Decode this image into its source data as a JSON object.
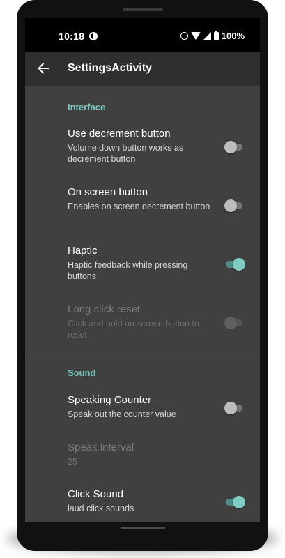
{
  "status_bar": {
    "time": "10:18",
    "battery": "100%"
  },
  "app_bar": {
    "title": "SettingsActivity"
  },
  "categories": {
    "interface": "Interface",
    "sound": "Sound"
  },
  "preferences": {
    "decrement_button": {
      "title": "Use decrement button",
      "summary": "Volume down button works as decrement button",
      "enabled": false
    },
    "on_screen_button": {
      "title": "On screen button",
      "summary": "Enables on screen decrement button",
      "enabled": false
    },
    "haptic": {
      "title": "Haptic",
      "summary": "Haptic feedback while pressing buttons",
      "enabled": true
    },
    "long_click_reset": {
      "title": "Long click reset",
      "summary": "Click and hold on screen button to reset",
      "enabled": false
    },
    "speaking_counter": {
      "title": "Speaking Counter",
      "summary": "Speak out the counter value",
      "enabled": false
    },
    "speak_interval": {
      "title": "Speak interval",
      "value": "25"
    },
    "click_sound": {
      "title": "Click Sound",
      "summary": "laud click sounds",
      "enabled": true
    }
  },
  "colors": {
    "accent": "#74c5bd",
    "background": "#404040",
    "app_bar": "#2f2f2f"
  }
}
